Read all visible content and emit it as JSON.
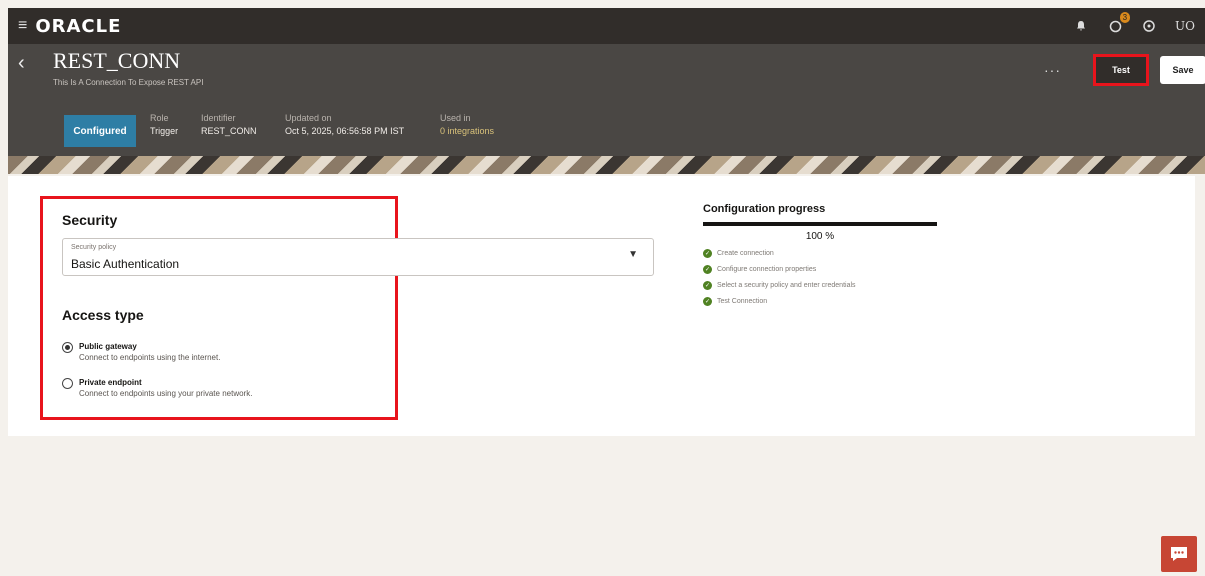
{
  "topbar": {
    "logo": "ORACLE",
    "user_initials": "UO",
    "notification_count": "3"
  },
  "header": {
    "title": "REST_CONN",
    "subtitle": "This Is A Connection To Expose REST API",
    "status": "Configured",
    "role_label": "Role",
    "role_value": "Trigger",
    "identifier_label": "Identifier",
    "identifier_value": "REST_CONN",
    "updated_label": "Updated on",
    "updated_value": "Oct 5, 2025, 06:56:58 PM IST",
    "used_label": "Used in",
    "used_value": "0 integrations",
    "test_label": "Test",
    "save_label": "Save",
    "more_label": "···"
  },
  "security": {
    "heading": "Security",
    "policy_label": "Security policy",
    "policy_value": "Basic Authentication"
  },
  "access": {
    "heading": "Access type",
    "options": [
      {
        "title": "Public gateway",
        "desc": "Connect to endpoints using the internet.",
        "selected": true
      },
      {
        "title": "Private endpoint",
        "desc": "Connect to endpoints using your private network.",
        "selected": false
      }
    ]
  },
  "progress": {
    "title": "Configuration progress",
    "percent": 100,
    "percent_text": "100 %",
    "steps": [
      "Create connection",
      "Configure connection properties",
      "Select a security policy and enter credentials",
      "Test Connection"
    ]
  },
  "colors": {
    "highlight": "#e8141c",
    "status_pill": "#2e7ea5",
    "check": "#508223",
    "chat": "#c74634"
  },
  "icons": [
    "hamburger-icon",
    "bell-icon",
    "badge-icon",
    "help-icon",
    "back-icon",
    "chevron-down-icon",
    "check-icon",
    "chat-icon"
  ]
}
